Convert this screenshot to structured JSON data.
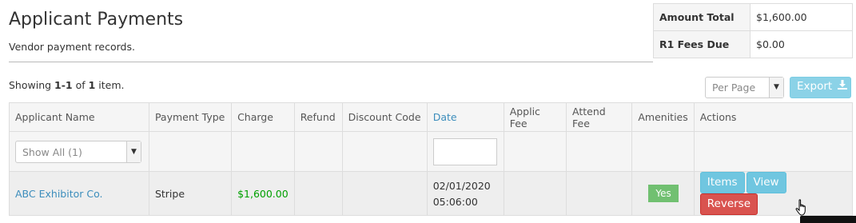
{
  "header": {
    "title": "Applicant Payments",
    "subtitle": "Vendor payment records."
  },
  "summary": [
    {
      "label": "Amount Total",
      "value": "$1,600.00"
    },
    {
      "label": "R1 Fees Due",
      "value": "$0.00"
    }
  ],
  "list_summary": {
    "prefix": "Showing ",
    "range": "1-1",
    "mid": " of ",
    "total": "1",
    "suffix": " item."
  },
  "toolbar": {
    "per_page_placeholder": "Per Page",
    "export_label": "Export"
  },
  "table": {
    "columns": [
      "Applicant Name",
      "Payment Type",
      "Charge",
      "Refund",
      "Discount Code",
      "Date",
      "Applic Fee",
      "Attend Fee",
      "Amenities",
      "Actions"
    ],
    "sorted_column": "Date",
    "filters": {
      "applicant_select": "Show All (1)",
      "date_input": ""
    },
    "rows": [
      {
        "applicant": "ABC Exhibitor Co.",
        "payment_type": "Stripe",
        "charge": "$1,600.00",
        "refund": "",
        "discount_code": "",
        "date": "02/01/2020",
        "time": "05:06:00",
        "applic_fee": "",
        "attend_fee": "",
        "amenities": "Yes",
        "actions": [
          "Items",
          "View",
          "Reverse"
        ]
      }
    ]
  },
  "colors": {
    "link": "#3c8dbc",
    "money": "#00a000",
    "info": "#5bc0de",
    "success": "#5cb85c",
    "danger": "#d9534f"
  },
  "icons": {
    "export": "download-icon",
    "select": "caret-down-icon",
    "cursor": "hand-pointer-cursor"
  }
}
